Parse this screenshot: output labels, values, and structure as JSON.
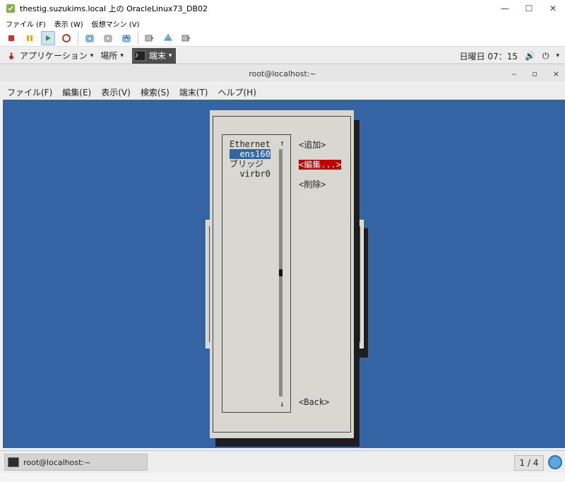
{
  "vm_window": {
    "title": "thestig.suzukims.local 上の OracleLinux73_DB02",
    "minimize_glyph": "—",
    "maximize_glyph": "☐",
    "close_glyph": "✕",
    "menu": [
      "ファイル (F)",
      "表示 (W)",
      "仮想マシン (V)"
    ],
    "toolbar_icons": [
      "stop-icon",
      "pause-icon",
      "play-icon",
      "reset-icon",
      "snapshot-icon",
      "snapshot-manager-icon",
      "revert-snapshot-icon",
      "vm-settings-icon",
      "console-icon",
      "send-keys-icon"
    ]
  },
  "gnome_panel": {
    "applications": "アプリケーション",
    "places": "場所",
    "terminal_task": "端末",
    "clock": "日曜日 07：15",
    "dropdown_glyph": "▾",
    "volume_glyph": "🔊",
    "power_glyph": "⏻"
  },
  "terminal": {
    "title": "root@localhost:~",
    "ctrl_glyphs": [
      "‒",
      "▫",
      "×"
    ],
    "menu": [
      "ファイル(F)",
      "編集(E)",
      "表示(V)",
      "検索(S)",
      "端末(T)",
      "ヘルプ(H)"
    ]
  },
  "nmtui": {
    "list": [
      {
        "text": "Ethernet",
        "selected": false
      },
      {
        "text": "  ens160",
        "selected": true
      },
      {
        "text": "ブリッジ",
        "selected": false
      },
      {
        "text": "  virbr0",
        "selected": false
      }
    ],
    "scroll_up": "↑",
    "scroll_down": "↓",
    "buttons": {
      "add": "<追加>",
      "edit": "<編集...>",
      "delete": "<削除>",
      "back": "<Back>"
    }
  },
  "taskbar": {
    "task_label": "root@localhost:~",
    "workspace": "1 / 4"
  },
  "colors": {
    "terminal_bg": "#3464a4",
    "dialog_bg": "#d8d8d0",
    "selected_button": "#c00000"
  }
}
